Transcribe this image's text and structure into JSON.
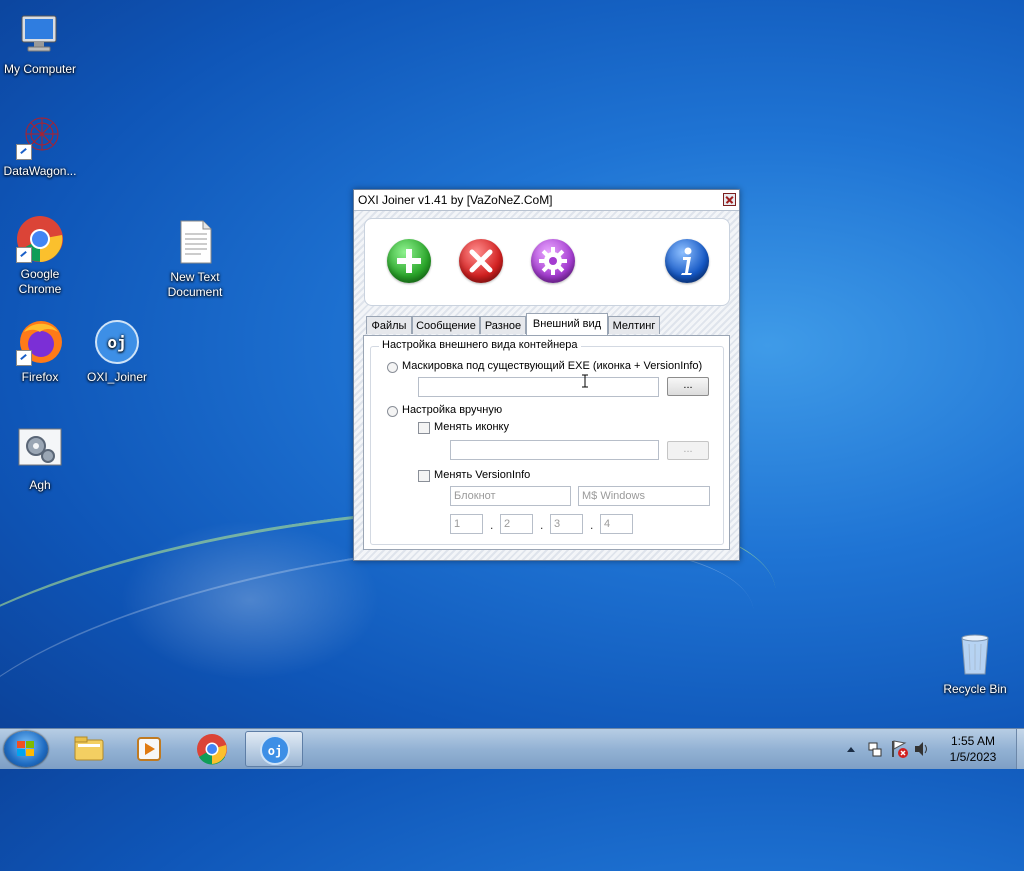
{
  "desktop": {
    "icons": [
      {
        "label": "My Computer"
      },
      {
        "label": "DataWagon..."
      },
      {
        "label": "Google Chrome"
      },
      {
        "label": "New Text Document"
      },
      {
        "label": "Firefox"
      },
      {
        "label": "OXI_Joiner"
      },
      {
        "label": "Agh"
      },
      {
        "label": "Recycle Bin"
      }
    ]
  },
  "window": {
    "title": "OXI Joiner v1.41 by [VaZoNeZ.CoM]",
    "toolbar": {
      "add_icon": "plus-icon",
      "remove_icon": "x-icon",
      "settings_icon": "gear-icon",
      "info_icon": "info-icon",
      "colors": {
        "add": "#2aa52a",
        "remove": "#d22020",
        "settings": "#a43cd0",
        "info": "#1457c4"
      }
    },
    "tabs": [
      {
        "label": "Файлы"
      },
      {
        "label": "Сообщение"
      },
      {
        "label": "Разное"
      },
      {
        "label": "Внешний вид"
      },
      {
        "label": "Мелтинг"
      }
    ],
    "active_tab": "Внешний вид",
    "appearance": {
      "group_title": "Настройка внешнего вида контейнера",
      "radio_mask_label": "Маскировка под существующий EXE (иконка + VersionInfo)",
      "exe_path_value": "",
      "browse_button": "...",
      "radio_manual_label": "Настройка вручную",
      "change_icon_label": "Менять иконку",
      "icon_path_value": "",
      "icon_browse_button": "...",
      "change_versioninfo_label": "Менять VersionInfo",
      "product_name_placeholder": "Блокнот",
      "company_placeholder": "M$ Windows",
      "version": [
        "1",
        "2",
        "3",
        "4"
      ],
      "version_separator": "."
    }
  },
  "taskbar": {
    "clock_time": "1:55 AM",
    "clock_date": "1/5/2023"
  }
}
